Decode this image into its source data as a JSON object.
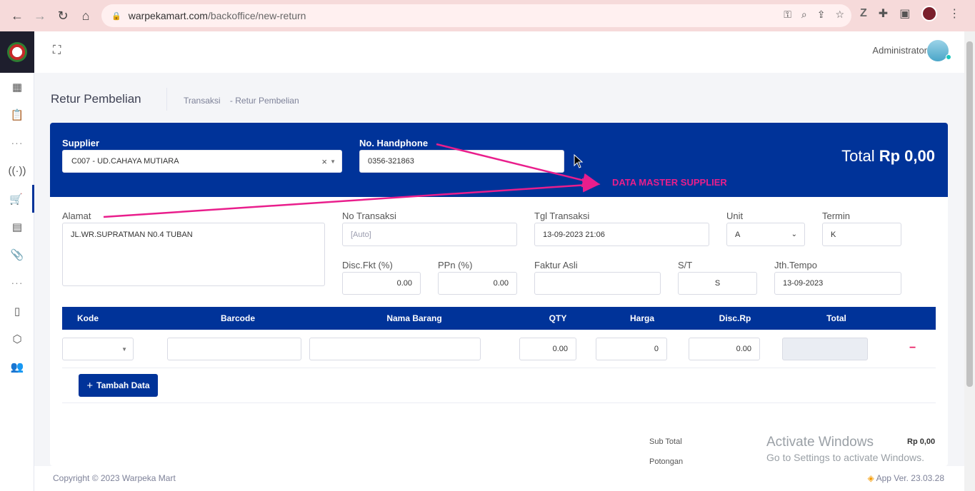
{
  "browser": {
    "url_host": "warpekamart.com",
    "url_path": "/backoffice/new-return"
  },
  "header": {
    "user_name": "Administrator"
  },
  "subheader": {
    "title": "Retur Pembelian",
    "crumb_1": "Transaksi",
    "crumb_sep": "-",
    "crumb_2": "Retur Pembelian"
  },
  "form": {
    "supplier_label": "Supplier",
    "supplier_value": "C007 - UD.CAHAYA MUTIARA",
    "supplier_clear": "×",
    "phone_label": "No. Handphone",
    "phone_value": "0356-321863",
    "total_label": "Total",
    "total_value": "Rp 0,00",
    "alamat_label": "Alamat",
    "alamat_value": "JL.WR.SUPRATMAN N0.4 TUBAN",
    "no_transaksi_label": "No Transaksi",
    "no_transaksi_placeholder": "[Auto]",
    "tgl_label": "Tgl Transaksi",
    "tgl_value": "13-09-2023 21:06",
    "unit_label": "Unit",
    "unit_value": "A",
    "termin_label": "Termin",
    "termin_value": "K",
    "disc_label": "Disc.Fkt (%)",
    "disc_value": "0.00",
    "ppn_label": "PPn (%)",
    "ppn_value": "0.00",
    "faktur_label": "Faktur Asli",
    "faktur_value": "",
    "st_label": "S/T",
    "st_value": "S",
    "jth_label": "Jth.Tempo",
    "jth_value": "13-09-2023"
  },
  "table": {
    "headers": [
      "Kode",
      "Barcode",
      "Nama Barang",
      "QTY",
      "Harga",
      "Disc.Rp",
      "Total"
    ],
    "row": {
      "qty": "0.00",
      "harga": "0",
      "disc": "0.00",
      "remove": "−"
    },
    "add_button": "Tambah Data"
  },
  "summary": {
    "subtotal_label": "Sub Total",
    "subtotal_value": "Rp 0,00",
    "potongan_label": "Potongan"
  },
  "annotation": "DATA MASTER SUPPLIER",
  "watermark": {
    "line1": "Activate Windows",
    "line2": "Go to Settings to activate Windows."
  },
  "footer": {
    "copyright": "Copyright © 2023 Warpeka Mart",
    "version": "App Ver. 23.03.28"
  },
  "colors": {
    "primary": "#003399",
    "annotation": "#e91e8c",
    "chrome_bar": "#f6dada"
  },
  "icons": [
    "back-icon",
    "forward-icon",
    "reload-icon",
    "home-icon",
    "lock-icon",
    "key-icon",
    "zoom-icon",
    "share-icon",
    "star-icon",
    "extension-icon",
    "puzzle-icon",
    "sidepanel-icon",
    "menu-icon",
    "fullscreen-icon",
    "plus-icon",
    "layers-icon"
  ]
}
